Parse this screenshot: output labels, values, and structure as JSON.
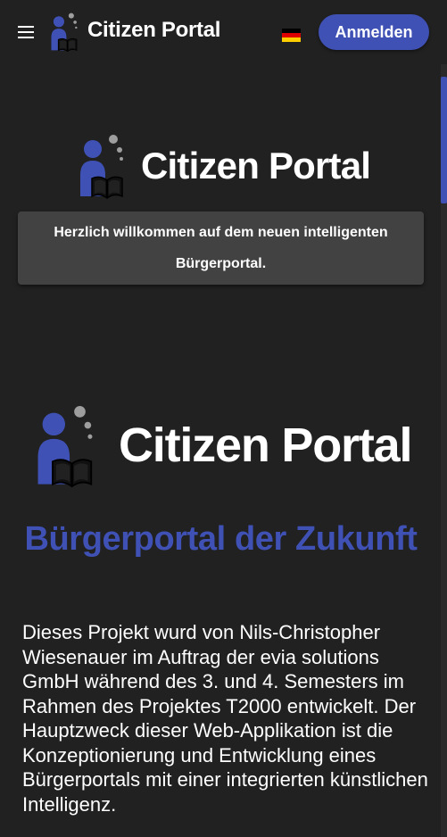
{
  "header": {
    "brand_name": "Citizen Portal",
    "login_label": "Anmelden",
    "language_icon": "flag-de-icon",
    "menu_icon": "menu-icon"
  },
  "hero": {
    "logo_text": "Citizen Portal",
    "welcome_message": "Herzlich willkommen auf dem neuen intelligenten Bürgerportal."
  },
  "about": {
    "logo_text": "Citizen Portal",
    "headline": "Bürgerportal der Zukunft",
    "description": "Dieses Projekt wurd von Nils-Christopher Wiesenauer im Auftrag der evia solutions GmbH während des 3. und 4. Semesters im Rahmen des Projektes T2000 entwickelt. Der Hauptzweck dieser Web-Applikation ist die Konzeptionierung und Entwicklung eines Bürgerportals mit einer integrierten künstlichen Intelligenz."
  },
  "colors": {
    "background": "#212121",
    "primary": "#3f51b5",
    "card": "#424242",
    "logo_dots": "#9e9e9e"
  }
}
